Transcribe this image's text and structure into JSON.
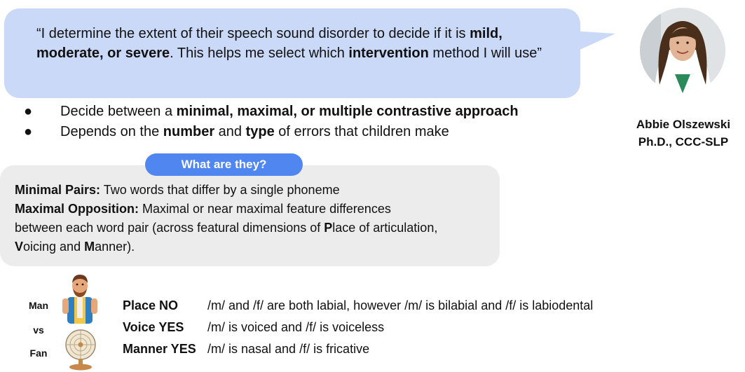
{
  "quote": {
    "segments": [
      {
        "text": "“I determine the extent of their speech sound disorder to decide if it is ",
        "bold": false
      },
      {
        "text": "mild, moderate, or severe",
        "bold": true
      },
      {
        "text": ".  This helps me select which ",
        "bold": false
      },
      {
        "text": "intervention",
        "bold": true
      },
      {
        "text": " method I will use”",
        "bold": false
      }
    ]
  },
  "bullets": [
    {
      "marker": "●",
      "segments": [
        {
          "text": "Decide between a ",
          "bold": false
        },
        {
          "text": "minimal, maximal, or multiple contrastive approach",
          "bold": true
        }
      ]
    },
    {
      "marker": "●",
      "segments": [
        {
          "text": "Depends on the ",
          "bold": false
        },
        {
          "text": "number",
          "bold": true
        },
        {
          "text": " and ",
          "bold": false
        },
        {
          "text": "type",
          "bold": true
        },
        {
          "text": " of errors that children make",
          "bold": false
        }
      ]
    }
  ],
  "speaker": {
    "name": "Abbie Olszewski",
    "credentials": "Ph.D., CCC-SLP"
  },
  "definitions": {
    "pill_label": "What are they?",
    "lines": [
      [
        {
          "text": "Minimal Pairs:",
          "bold": true
        },
        {
          "text": " Two words that differ by a single phoneme",
          "bold": false
        }
      ],
      [
        {
          "text": "Maximal Opposition:",
          "bold": true
        },
        {
          "text": " Maximal or near maximal feature differences",
          "bold": false
        }
      ],
      [
        {
          "text": "between each word pair (across featural dimensions of ",
          "bold": false
        },
        {
          "text": "P",
          "bold": true
        },
        {
          "text": "lace of articulation,",
          "bold": false
        }
      ],
      [
        {
          "text": "V",
          "bold": true
        },
        {
          "text": "oicing and ",
          "bold": false
        },
        {
          "text": "M",
          "bold": true
        },
        {
          "text": "anner).",
          "bold": false
        }
      ]
    ]
  },
  "example": {
    "word1": "Man",
    "vs": "vs",
    "word2": "Fan",
    "rows": [
      {
        "label": "Place NO",
        "text": "/m/ and /f/ are both labial, however /m/ is bilabial and /f/ is labiodental"
      },
      {
        "label": "Voice YES",
        "text": "/m/ is voiced and /f/ is voiceless"
      },
      {
        "label": "Manner YES",
        "text": "/m/ is nasal and /f/ is fricative"
      }
    ]
  },
  "colors": {
    "bubble": "#c9d9f7",
    "pill": "#4f86f0",
    "box": "#ececec"
  }
}
